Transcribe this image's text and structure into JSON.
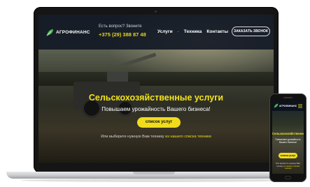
{
  "site": {
    "logo_text": "АГРОФИНАНС",
    "contact_question": "Есть вопрос? Звоните",
    "phone_number": "+375 (29) 388 87 48",
    "nav": [
      "Услуги",
      "Техника",
      "Контакты"
    ],
    "order_call_label": "ЗАКАЗАТЬ ЗВОНОК",
    "hero_title": "Сельскохозяйственные услуги",
    "hero_subtitle": "Повышаем урожайность Вашего бизнеса!",
    "services_button_label": "список услуг",
    "hero_note_prefix": "Или выберите нужную Вам технику",
    "hero_note_link": "из нашего списка техники"
  },
  "colors": {
    "accent": "#f0dc1b",
    "title_yellow": "#f4e31d",
    "header_bg": "#0e1422",
    "phone_text": "#e6d21c"
  },
  "icons": {
    "logo": "leaf-logo-icon",
    "menu": "hamburger-menu-icon"
  }
}
